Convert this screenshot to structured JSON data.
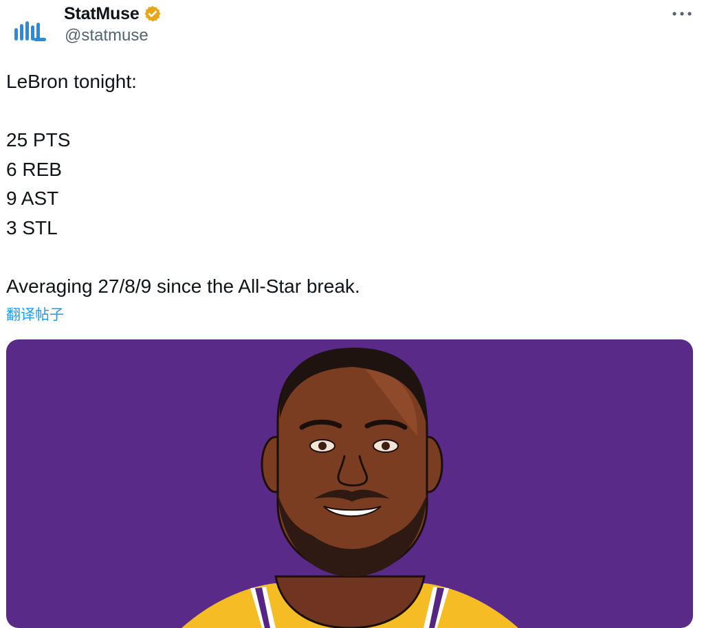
{
  "author": {
    "display_name": "StatMuse",
    "handle": "@statmuse",
    "verified": true,
    "verified_badge_color": "#e8a816",
    "avatar_icon": "statmuse-logo-icon",
    "avatar_color": "#2a8bd8"
  },
  "menu": {
    "more_icon": "more-horizontal-icon",
    "more_glyph": "···"
  },
  "tweet": {
    "lines": [
      "LeBron tonight:",
      "",
      "25 PTS",
      "6 REB",
      "9 AST",
      "3 STL",
      "",
      "Averaging 27/8/9 since the All-Star break."
    ],
    "translate_label": "翻译帖子"
  },
  "media": {
    "background_color": "#592a88",
    "jersey_color": "#f5bd24",
    "skin_color": "#7b3d22",
    "beard_color": "#2e1a12"
  },
  "theme": {
    "link_color": "#1d9bf0",
    "secondary_text": "#536471"
  }
}
